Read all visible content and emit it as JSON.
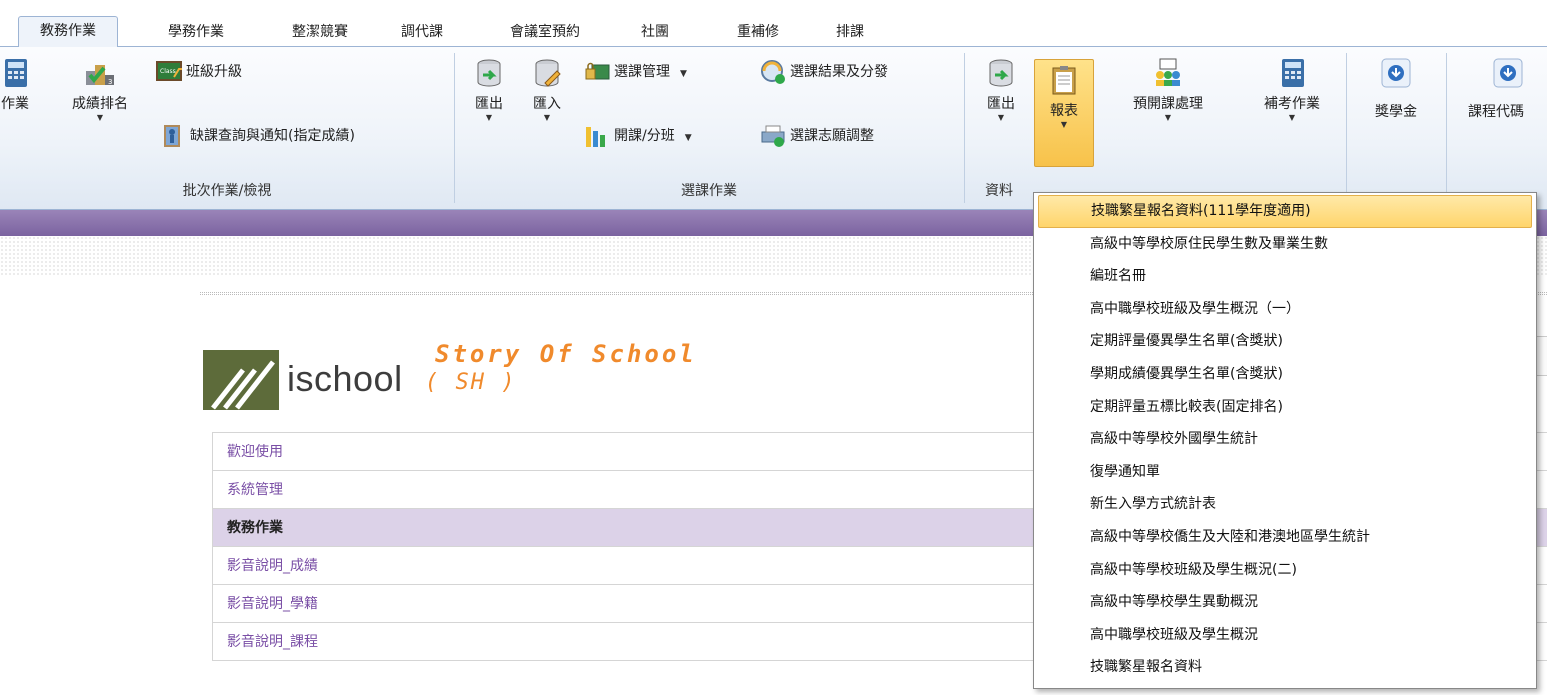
{
  "tabs": [
    "教務作業",
    "學務作業",
    "整潔競賽",
    "調代課",
    "會議室預約",
    "社團",
    "重補修",
    "排課"
  ],
  "ribbon": {
    "batch_group": {
      "label": "批次作業/檢視",
      "partial_btn": "作業",
      "rank_btn": "成績排名",
      "promote_btn": "班級升級",
      "absence_btn": "缺課查詢與通知(指定成績)"
    },
    "course_group": {
      "label": "選課作業",
      "export_btn": "匯出",
      "import_btn": "匯入",
      "manage_btn": "選課管理",
      "open_btn": "開課/分班",
      "result_btn": "選課結果及分發",
      "adjust_btn": "選課志願調整"
    },
    "data_group": {
      "label": "資料",
      "export_btn": "匯出",
      "report_btn": "報表",
      "pre_open_btn": "預開課處理",
      "makeup_btn": "補考作業",
      "scholarship_btn": "獎學金",
      "course_code_btn": "課程代碼"
    }
  },
  "logo": {
    "brand": "ischool",
    "tagline": "Story Of School",
    "sub": "( SH )"
  },
  "menu": [
    "歡迎使用",
    "系統管理",
    "教務作業",
    "影音說明_成績",
    "影音說明_學籍",
    "影音說明_課程"
  ],
  "active_menu_index": 2,
  "dropdown": [
    "技職繁星報名資料(111學年度適用)",
    "高級中等學校原住民學生數及畢業生數",
    "編班名冊",
    "高中職學校班級及學生概況（一）",
    "定期評量優異學生名單(含獎狀)",
    "學期成績優異學生名單(含獎狀)",
    "定期評量五標比較表(固定排名)",
    "高級中等學校外國學生統計",
    "復學通知單",
    "新生入學方式統計表",
    "高級中等學校僑生及大陸和港澳地區學生統計",
    "高級中等學校班級及學生概況(二)",
    "高級中等學校學生異動概況",
    "高中職學校班級及學生概況",
    "技職繁星報名資料"
  ],
  "colors": {
    "accent_purple": "#7a4fa6",
    "ribbon_border": "#9db4d4",
    "highlight": "#ffd56b",
    "logo_orange": "#f08a2c"
  }
}
